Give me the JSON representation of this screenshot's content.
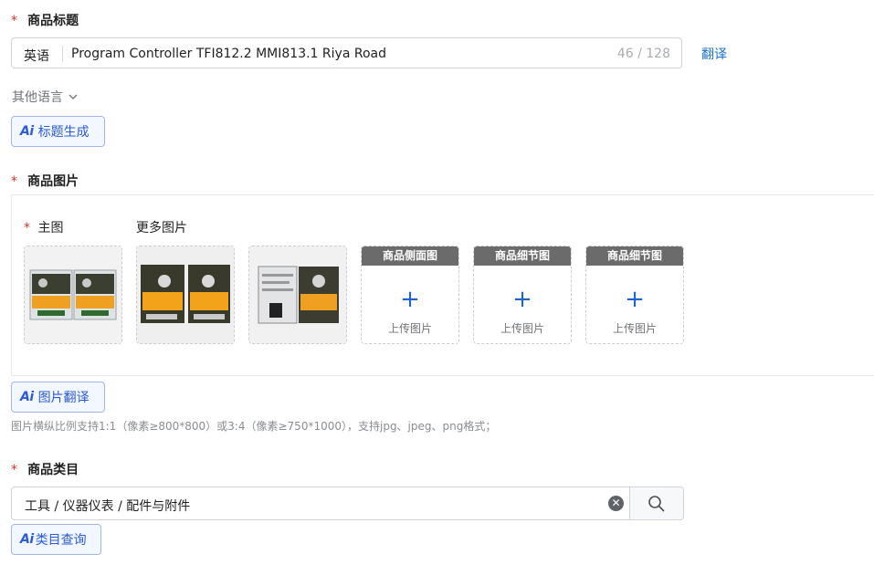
{
  "title_section": {
    "required_mark": "*",
    "label": "商品标题",
    "language": "英语",
    "value": "Program Controller TFI812.2 MMI813.1 Riya Road",
    "counter": "46 / 128",
    "translate": "翻译",
    "other_languages": "其他语言",
    "ai_button": "标题生成"
  },
  "images_section": {
    "required_mark": "*",
    "label": "商品图片",
    "main_required_mark": "*",
    "main_label": "主图",
    "more_label": "更多图片",
    "upload_slots": [
      {
        "header": "商品侧面图",
        "text": "上传图片"
      },
      {
        "header": "商品细节图",
        "text": "上传图片"
      },
      {
        "header": "商品细节图",
        "text": "上传图片"
      }
    ],
    "ai_button": "图片翻译",
    "hint": "图片横纵比例支持1:1（像素≥800*800）或3:4（像素≥750*1000），支持jpg、jpeg、png格式；"
  },
  "category_section": {
    "required_mark": "*",
    "label": "商品类目",
    "value": "工具 / 仪器仪表 / 配件与附件",
    "ai_button": "类目查询"
  },
  "ai_logo": "Ai",
  "colors": {
    "accent": "#2a5bd7",
    "link": "#1a73c8",
    "required": "#e0302a"
  }
}
